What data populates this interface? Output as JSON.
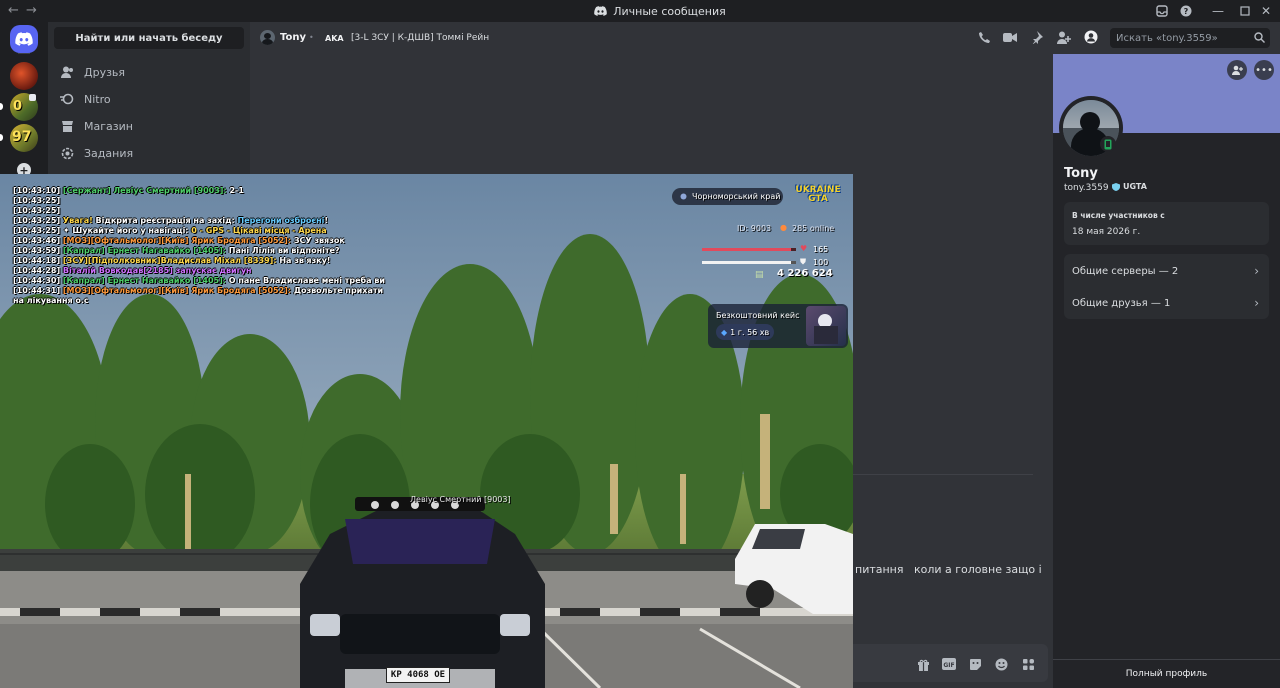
{
  "window": {
    "title": "Личные сообщения"
  },
  "sidebar": {
    "search_label": "Найти или начать беседу",
    "items": [
      {
        "label": "Друзья"
      },
      {
        "label": "Nitro"
      },
      {
        "label": "Магазин"
      },
      {
        "label": "Задания"
      }
    ]
  },
  "header": {
    "username": "Tony",
    "aka_label": "AKA",
    "aka_names": "[3-L ЗСУ | К-ДШВ] Томмі Рейн",
    "search_placeholder": "Искать «tony.3559»"
  },
  "message": {
    "text": "питання   коли а головне защо і"
  },
  "profile": {
    "display_name": "Tony",
    "handle": "tony.3559",
    "tag": "UGTA",
    "member_since_label": "В числе участников с",
    "member_since_date": "18 мая 2026 г.",
    "mutual_servers": "Общие серверы — 2",
    "mutual_friends": "Общие друзья — 1",
    "full_profile": "Полный профиль"
  },
  "game": {
    "chat": [
      {
        "time": "[10:43:10]",
        "parts": [
          {
            "t": " [Сержант] Левіус Смертний [9003]:",
            "c": "#4fd06a"
          },
          {
            "t": " 2-1",
            "c": "#ffffff"
          }
        ]
      },
      {
        "time": "[10:43:25]",
        "parts": []
      },
      {
        "time": "[10:43:25]",
        "parts": []
      },
      {
        "time": "[10:43:25]",
        "parts": [
          {
            "t": " Увага!",
            "c": "#ffd84a"
          },
          {
            "t": " Відкрита реєстрація на захід: ",
            "c": "#ffffff"
          },
          {
            "t": "Перегони озброєні",
            "c": "#66ccff"
          },
          {
            "t": "!",
            "c": "#ffffff"
          }
        ]
      },
      {
        "time": "[10:43:25]",
        "parts": [
          {
            "t": " ✦ Шукайте його у навігаці:",
            "c": "#ffffff"
          },
          {
            "t": " 0 - GPS - Цікаві місця - Арена",
            "c": "#ffd84a"
          }
        ]
      },
      {
        "time": "[10:43:46]",
        "parts": [
          {
            "t": " [МОЗ][Офтальмолог][Київ] Ярик Бродяга [5052]:",
            "c": "#ff9a3c"
          },
          {
            "t": " ЗСУ звязок",
            "c": "#ffffff"
          }
        ]
      },
      {
        "time": "[10:43:59]",
        "parts": [
          {
            "t": " [Капрал] Ернест Нагавайко [1405]:",
            "c": "#4fd06a"
          },
          {
            "t": " Пані Лілія ви відпоніте?",
            "c": "#ffffff"
          }
        ]
      },
      {
        "time": "[10:44:18]",
        "parts": [
          {
            "t": " [ЗСУ][Підполковник]Владислав Міхал [8339]:",
            "c": "#ffd84a"
          },
          {
            "t": " На зв'язку!",
            "c": "#ffffff"
          }
        ]
      },
      {
        "time": "[10:44:28]",
        "parts": [
          {
            "t": " Віталій Вовкодав[2185] запускає двигун",
            "c": "#d070ff"
          }
        ]
      },
      {
        "time": "[10:44:30]",
        "parts": [
          {
            "t": " [Капрал] Ернест Нагавайко [1405]:",
            "c": "#4fd06a"
          },
          {
            "t": " О пане Владиславе мені треба ви",
            "c": "#ffffff"
          }
        ]
      },
      {
        "time": "[10:44:31]",
        "parts": [
          {
            "t": " [МОЗ][Офтальмолог][Київ] Ярик Бродяга [5052]:",
            "c": "#ff9a3c"
          },
          {
            "t": " Дозвольте прихати",
            "c": "#ffffff"
          }
        ]
      },
      {
        "time": "",
        "parts": [
          {
            "t": "на лікування о.с",
            "c": "#ffffff"
          }
        ]
      }
    ],
    "region": "Чорноморський край",
    "logo_text": "UKRAINE GTA",
    "player_id": "ID: 9003",
    "online": "285 online",
    "health": "165",
    "armor": "100",
    "health_fraction": 0.95,
    "armor_fraction": 0.95,
    "money": "4 226 624",
    "case_title": "Безкоштовний кейс",
    "case_timer": "1 г. 56 хв",
    "player_tag": "Левіус Смертний [9003]",
    "plate": "KP 4068 OE"
  }
}
